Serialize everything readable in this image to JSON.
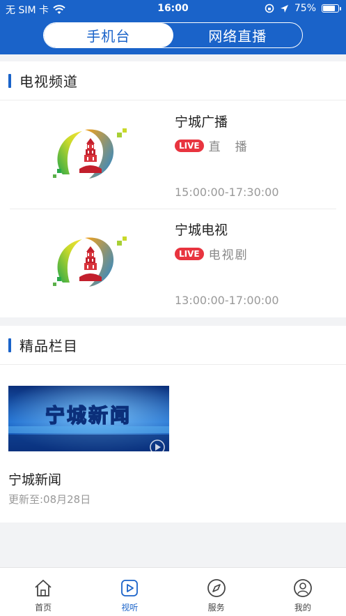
{
  "status_bar": {
    "carrier": "无 SIM 卡",
    "time": "16:00",
    "battery": "75%"
  },
  "segmented": {
    "tabs": [
      {
        "label": "手机台"
      },
      {
        "label": "网络直播"
      }
    ],
    "active_index": 0
  },
  "tv_section": {
    "title": "电视频道",
    "channels": [
      {
        "name": "宁城广播",
        "badge": "LIVE",
        "program": "直　播",
        "time": "15:00:00-17:30:00"
      },
      {
        "name": "宁城电视",
        "badge": "LIVE",
        "program": "电视剧",
        "time": "13:00:00-17:00:00"
      }
    ]
  },
  "premium_section": {
    "title": "精品栏目",
    "items": [
      {
        "title": "宁城新闻",
        "update": "更新至:08月28日",
        "thumb_text": "宁城新闻"
      }
    ]
  },
  "tabbar": {
    "items": [
      {
        "label": "首页",
        "icon": "home-icon"
      },
      {
        "label": "视听",
        "icon": "play-icon"
      },
      {
        "label": "服务",
        "icon": "compass-icon"
      },
      {
        "label": "我的",
        "icon": "user-icon"
      }
    ],
    "active_index": 1
  },
  "colors": {
    "brand": "#1a63c9",
    "live": "#e8343f"
  }
}
